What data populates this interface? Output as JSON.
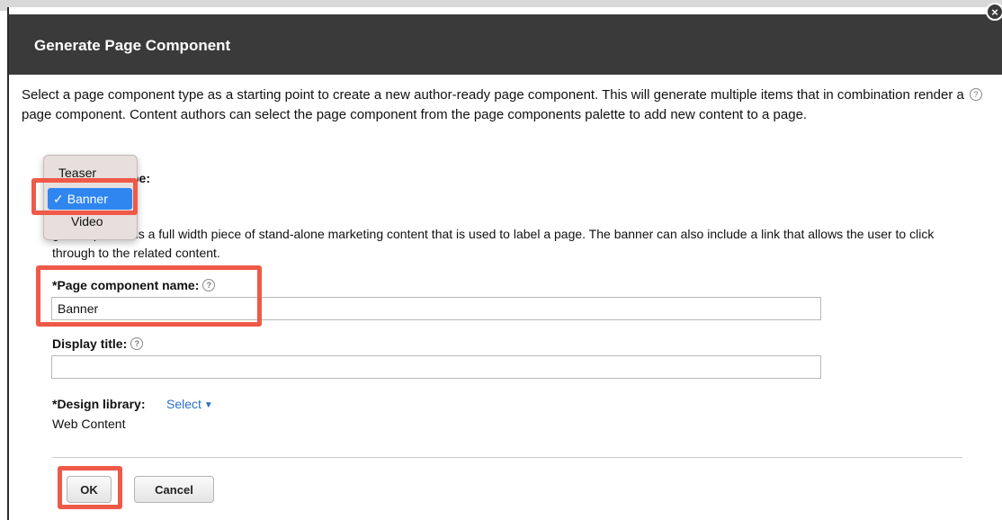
{
  "dialog": {
    "title": "Generate Page Component",
    "description": "Select a page component type as a starting point to create a new author-ready page component. This will generate multiple items that in combination render a page component. Content authors can select the page component from the page components palette to add new content to a page."
  },
  "type_field": {
    "label_visible_tail": "pe:",
    "options": [
      "Teaser",
      "Banner",
      "Video"
    ],
    "selected": "Banner",
    "check_glyph": "✓",
    "selected_description_visible": "ge component is a full width piece of stand-alone marketing content that is used to label a page. The banner can also include a link that allows the user to click through to the related content."
  },
  "name_field": {
    "label": "*Page component name:",
    "value": "Banner"
  },
  "title_field": {
    "label": "Display title:",
    "value": ""
  },
  "design_library": {
    "label": "*Design library:",
    "select_label": "Select",
    "value": "Web Content"
  },
  "buttons": {
    "ok": "OK",
    "cancel": "Cancel"
  },
  "icons": {
    "help": "?",
    "close": "×",
    "caret": "▼"
  },
  "colors": {
    "titlebar": "#3a3a3a",
    "link": "#2a6fc9",
    "selected_option": "#2f86f1",
    "highlight": "#ee5a47"
  }
}
